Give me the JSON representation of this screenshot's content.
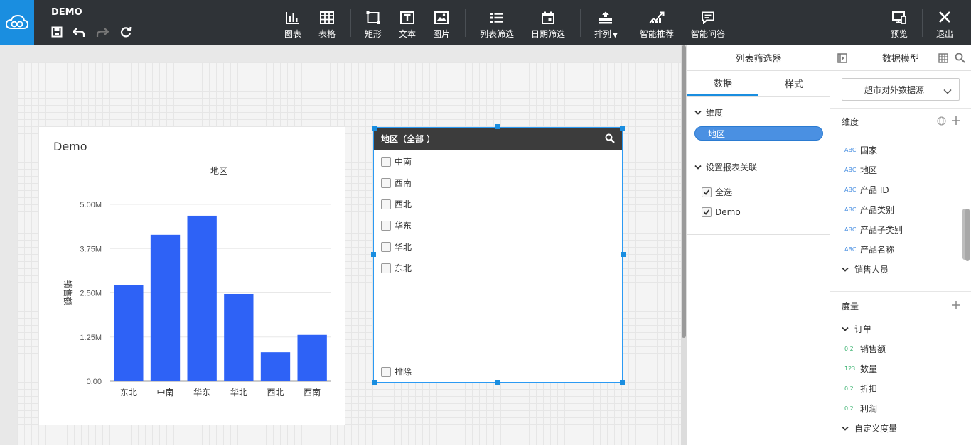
{
  "app": {
    "title": "DEMO"
  },
  "toolbar": {
    "tools": [
      {
        "id": "chart",
        "label": "图表",
        "icon": "bar-chart-icon"
      },
      {
        "id": "table",
        "label": "表格",
        "icon": "table-icon"
      },
      {
        "id": "rect",
        "label": "矩形",
        "icon": "rectangle-icon"
      },
      {
        "id": "text",
        "label": "文本",
        "icon": "text-icon"
      },
      {
        "id": "image",
        "label": "图片",
        "icon": "image-icon"
      },
      {
        "id": "list-filter",
        "label": "列表筛选",
        "icon": "list-icon"
      },
      {
        "id": "date-filter",
        "label": "日期筛选",
        "icon": "calendar-icon"
      },
      {
        "id": "arrange",
        "label": "排列",
        "icon": "arrange-icon"
      },
      {
        "id": "smart-rec",
        "label": "智能推荐",
        "icon": "trend-icon"
      },
      {
        "id": "smart-qa",
        "label": "智能问答",
        "icon": "chat-icon"
      }
    ],
    "preview": "预览",
    "exit": "退出"
  },
  "chart": {
    "title": "Demo",
    "chart_data": {
      "type": "bar",
      "title": "地区",
      "xlabel": "",
      "ylabel": "销售额",
      "categories": [
        "东北",
        "中南",
        "华东",
        "华北",
        "西北",
        "西南"
      ],
      "values": [
        2.73,
        4.14,
        4.68,
        2.47,
        0.82,
        1.31
      ],
      "unit": "M",
      "ylim": [
        0,
        5
      ],
      "yticks": [
        "0.00",
        "1.25M",
        "2.50M",
        "3.75M",
        "5.00M"
      ],
      "grid": true,
      "color": "#2e62f6"
    }
  },
  "filter": {
    "header": "地区（全部 ）",
    "items": [
      "中南",
      "西南",
      "西北",
      "华东",
      "华北",
      "东北"
    ],
    "exclude": "排除"
  },
  "props": {
    "title": "列表筛选器",
    "tabs": [
      "数据",
      "样式"
    ],
    "dimension_section": "维度",
    "dimension_field": "地区",
    "link_section": "设置报表关联",
    "links": [
      {
        "label": "全选",
        "checked": true
      },
      {
        "label": "Demo",
        "checked": true
      }
    ]
  },
  "model": {
    "title": "数据模型",
    "datasource": "超市对外数据源",
    "dim_title": "维度",
    "dims": [
      {
        "type": "ABC",
        "label": "国家"
      },
      {
        "type": "ABC",
        "label": "地区"
      },
      {
        "type": "ABC",
        "label": "产品 ID"
      },
      {
        "type": "ABC",
        "label": "产品类别"
      },
      {
        "type": "ABC",
        "label": "产品子类别"
      },
      {
        "type": "ABC",
        "label": "产品名称"
      }
    ],
    "dim_group": "销售人员",
    "measure_title": "度量",
    "measure_group": "订单",
    "measures": [
      {
        "type": "0.2",
        "label": "销售额"
      },
      {
        "type": "123",
        "label": "数量"
      },
      {
        "type": "0.2",
        "label": "折扣"
      },
      {
        "type": "0.2",
        "label": "利润"
      }
    ],
    "custom_group": "自定义度量"
  },
  "colors": {
    "accent": "#1a8ee0",
    "bar": "#2e62f6",
    "topbar": "#2f3337"
  }
}
